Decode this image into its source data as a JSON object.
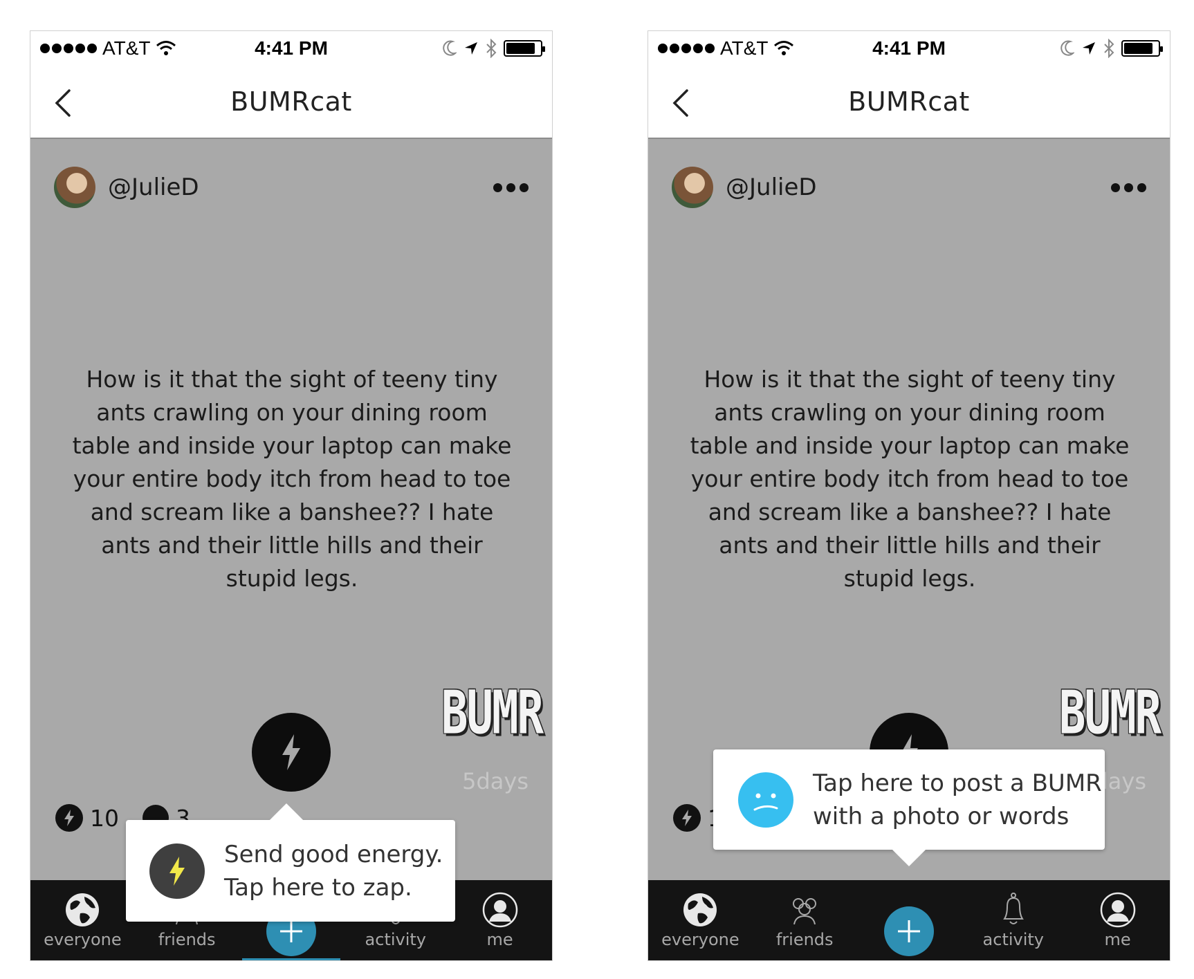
{
  "status_bar": {
    "carrier": "AT&T",
    "time": "4:41 PM",
    "battery_level": 0.85,
    "icons": [
      "signal-dots-icon",
      "wifi-icon",
      "moon-icon",
      "location-arrow-icon",
      "bluetooth-icon",
      "battery-icon"
    ]
  },
  "nav": {
    "title": "BUMRcat",
    "back_icon": "chevron-left-icon"
  },
  "post": {
    "username": "@JulieD",
    "more_icon": "ellipsis-icon",
    "text": "How is it that the sight of teeny tiny ants crawling on your dining room table and inside your laptop can make your entire body itch from head to toe and scream like a banshee?? I hate ants and their little hills and their stupid legs.",
    "logo": "BUMR",
    "time_ago": "5days",
    "zap_count": "10",
    "comment_count": "3"
  },
  "tabs": [
    {
      "label": "everyone",
      "icon": "globe-icon"
    },
    {
      "label": "friends",
      "icon": "people-icon"
    },
    {
      "label": "",
      "icon": "plus-icon"
    },
    {
      "label": "activity",
      "icon": "bell-icon"
    },
    {
      "label": "me",
      "icon": "person-icon"
    }
  ],
  "tooltips": {
    "zap": {
      "line1": "Send good energy.",
      "line2": "Tap here to zap.",
      "icon": "lightning-icon"
    },
    "post": {
      "line1": "Tap here to post a BUMR",
      "line2": "with a photo or words",
      "icon": "sad-face-icon"
    }
  },
  "colors": {
    "accent": "#2e8fb3",
    "background": "#a9a9a9",
    "tab_bar": "#141414",
    "zap_yellow": "#f2e84a",
    "sad_face": "#37bff0"
  }
}
